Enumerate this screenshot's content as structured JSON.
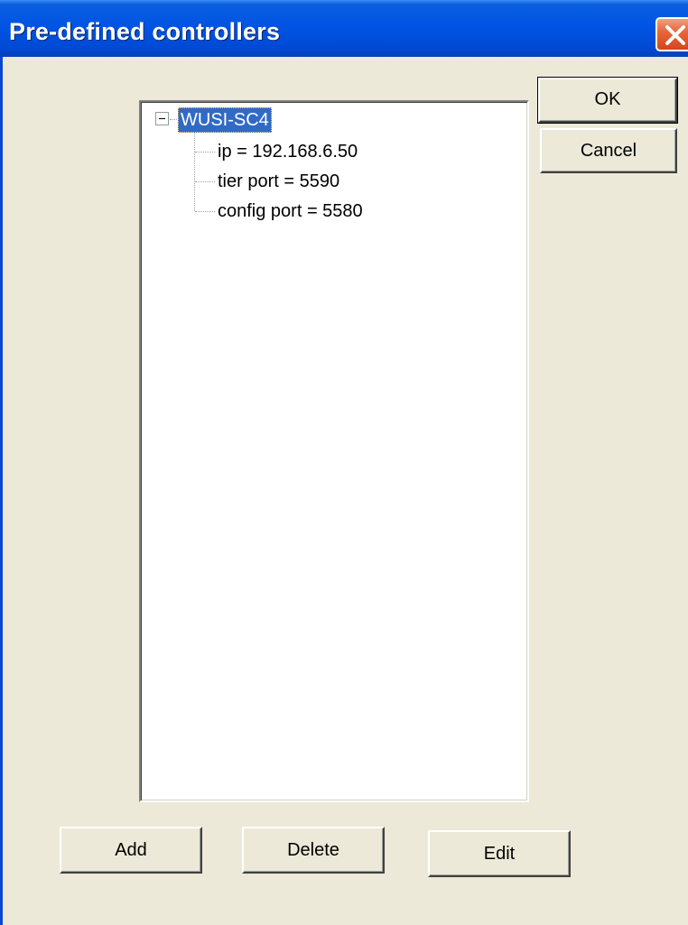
{
  "window": {
    "title": "Pre-defined controllers",
    "close_icon": "close-icon"
  },
  "tree": {
    "root": {
      "label": "WUSI-SC4",
      "expanded": true,
      "selected": true
    },
    "children": [
      {
        "label": "ip = 192.168.6.50"
      },
      {
        "label": "tier port = 5590"
      },
      {
        "label": "config port = 5580"
      }
    ]
  },
  "buttons": {
    "ok": "OK",
    "cancel": "Cancel",
    "add": "Add",
    "delete": "Delete",
    "edit": "Edit"
  },
  "colors": {
    "titlebar": "#0054e3",
    "dialog_bg": "#ece9d8",
    "selection": "#316ac5",
    "close_button": "#e8673f"
  }
}
